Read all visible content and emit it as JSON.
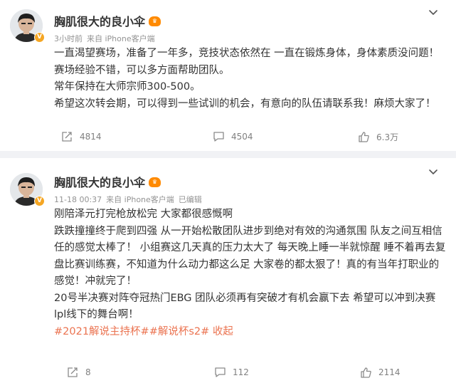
{
  "posts": [
    {
      "username": "胸肌很大的良小伞",
      "meta": {
        "time": "3小时前",
        "source": "来自 iPhone客户端"
      },
      "paragraphs": [
        "一直渴望赛场，准备了一年多，竞技状态依然在 一直在锻炼身体，身体素质没问题！",
        "赛场经验不错，可以多方面帮助团队。",
        "常年保持在大师宗师300-500。",
        "希望这次转会期，可以得到一些试训的机会，有意向的队伍请联系我！麻烦大家了！"
      ],
      "stats": {
        "reposts": "4814",
        "comments": "4504",
        "likes": "6.3万"
      }
    },
    {
      "username": "胸肌很大的良小伞",
      "meta": {
        "time": "11-18 00:37",
        "source": "来自 iPhone客户端",
        "edited": "已编辑"
      },
      "paragraphs": [
        "刚陪泽元打完枪放松完 大家都很感慨啊",
        "跌跌撞撞终于爬到四强 从一开始松散团队进步到绝对有效的沟通氛围 队友之间互相信任的感觉太棒了！ 小组赛这几天真的压力太大了 每天晚上睡一半就惊醒 睡不着再去复盘比赛训练赛，不知道为什么动力都这么足 大家卷的都太狠了！真的有当年打职业的感觉！冲就完了！",
        "20号半决赛对阵夺冠热门EBG 团队必须再有突破才有机会赢下去 希望可以冲到决赛 lpl线下的舞台啊！"
      ],
      "hashtags": "#2021解说主持杯##解说杯s2#",
      "collapse": "收起",
      "stats": {
        "reposts": "8",
        "comments": "112",
        "likes": "2114"
      }
    }
  ],
  "colors": {
    "accent": "#eb7350",
    "meta": "#939393",
    "badge": "#f5a623",
    "separator": "#f1f2f5"
  },
  "icons": [
    "more-chevron-icon",
    "repost-icon",
    "comment-icon",
    "like-icon",
    "verified-icon",
    "level-badge-icon"
  ]
}
